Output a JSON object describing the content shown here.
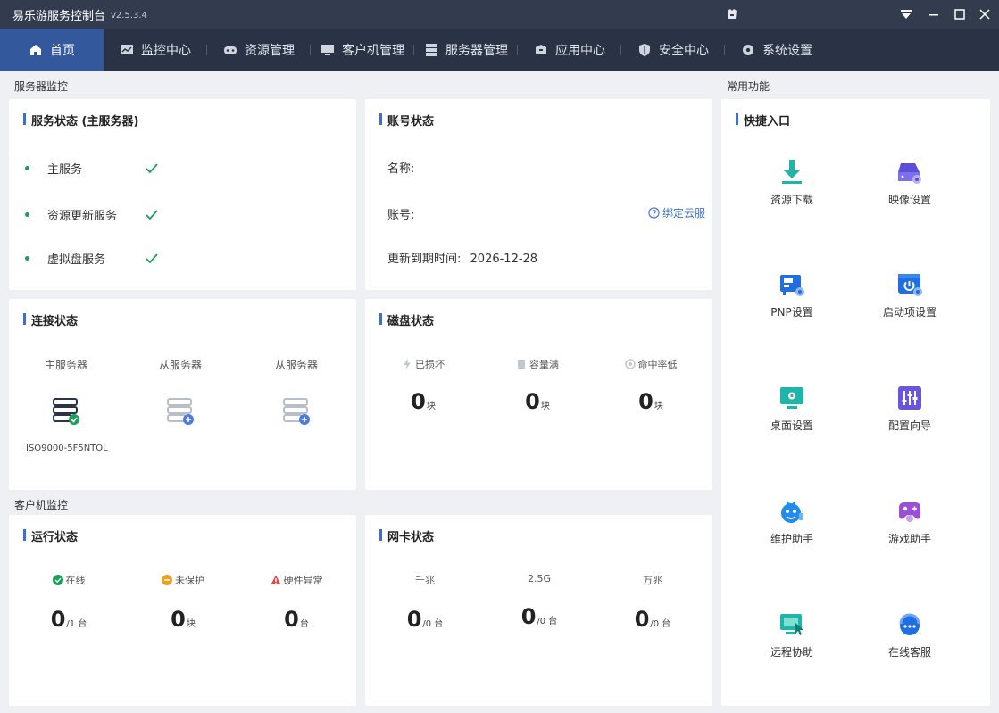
{
  "app": {
    "title": "易乐游服务控制台",
    "version": "v2.5.3.4"
  },
  "colors": {
    "accent": "#3a6fd8",
    "titlebar": "#333c4f",
    "navbar": "#2a3346",
    "nav_active": "#34589c",
    "success": "#18a058",
    "warning": "#f0a020",
    "danger": "#e04848"
  },
  "nav": {
    "items": [
      {
        "label": "首页",
        "icon": "home-icon"
      },
      {
        "label": "监控中心",
        "icon": "monitor-chart-icon"
      },
      {
        "label": "资源管理",
        "icon": "gamepad-icon"
      },
      {
        "label": "客户机管理",
        "icon": "desktop-icon"
      },
      {
        "label": "服务器管理",
        "icon": "server-icon"
      },
      {
        "label": "应用中心",
        "icon": "box-icon"
      },
      {
        "label": "安全中心",
        "icon": "shield-icon"
      },
      {
        "label": "系统设置",
        "icon": "gear-icon"
      }
    ]
  },
  "sections": {
    "server_monitor": "服务器监控",
    "client_monitor": "客户机监控",
    "common_functions": "常用功能"
  },
  "service_status": {
    "title": "服务状态 (主服务器)",
    "items": [
      "主服务",
      "资源更新服务",
      "虚拟盘服务"
    ]
  },
  "account_status": {
    "title": "账号状态",
    "name_label": "名称:",
    "account_label": "账号:",
    "expiry_label": "更新到期时间:",
    "expiry_value": "2026-12-28",
    "bind_link": "绑定云服"
  },
  "connection_status": {
    "title": "连接状态",
    "servers": [
      {
        "label": "主服务器",
        "id": "ISO9000-5F5NTOL"
      },
      {
        "label": "从服务器"
      },
      {
        "label": "从服务器"
      }
    ]
  },
  "disk_status": {
    "title": "磁盘状态",
    "items": [
      {
        "label": "已损坏",
        "value": "0",
        "unit": "块"
      },
      {
        "label": "容量满",
        "value": "0",
        "unit": "块"
      },
      {
        "label": "命中率低",
        "value": "0",
        "unit": "块"
      }
    ]
  },
  "run_status": {
    "title": "运行状态",
    "items": [
      {
        "label": "在线",
        "value": "0",
        "unit": "/1 台"
      },
      {
        "label": "未保护",
        "value": "0",
        "unit": "块"
      },
      {
        "label": "硬件异常",
        "value": "0",
        "unit": "台"
      }
    ]
  },
  "nic_status": {
    "title": "网卡状态",
    "items": [
      {
        "label": "千兆",
        "value": "0",
        "unit": "/0 台"
      },
      {
        "label": "2.5G",
        "value": "0",
        "unit": "/0 台"
      },
      {
        "label": "万兆",
        "value": "0",
        "unit": "/0 台"
      }
    ]
  },
  "quick_entry": {
    "title": "快捷入口",
    "items": [
      {
        "label": "资源下载",
        "icon": "download-icon"
      },
      {
        "label": "映像设置",
        "icon": "disk-image-settings-icon"
      },
      {
        "label": "PNP设置",
        "icon": "network-card-settings-icon"
      },
      {
        "label": "启动项设置",
        "icon": "startup-settings-icon"
      },
      {
        "label": "桌面设置",
        "icon": "desktop-settings-icon"
      },
      {
        "label": "配置向导",
        "icon": "config-wizard-icon"
      },
      {
        "label": "维护助手",
        "icon": "maintenance-assistant-icon"
      },
      {
        "label": "游戏助手",
        "icon": "game-assistant-icon"
      },
      {
        "label": "远程协助",
        "icon": "remote-assist-icon"
      },
      {
        "label": "在线客服",
        "icon": "online-support-icon"
      }
    ]
  }
}
